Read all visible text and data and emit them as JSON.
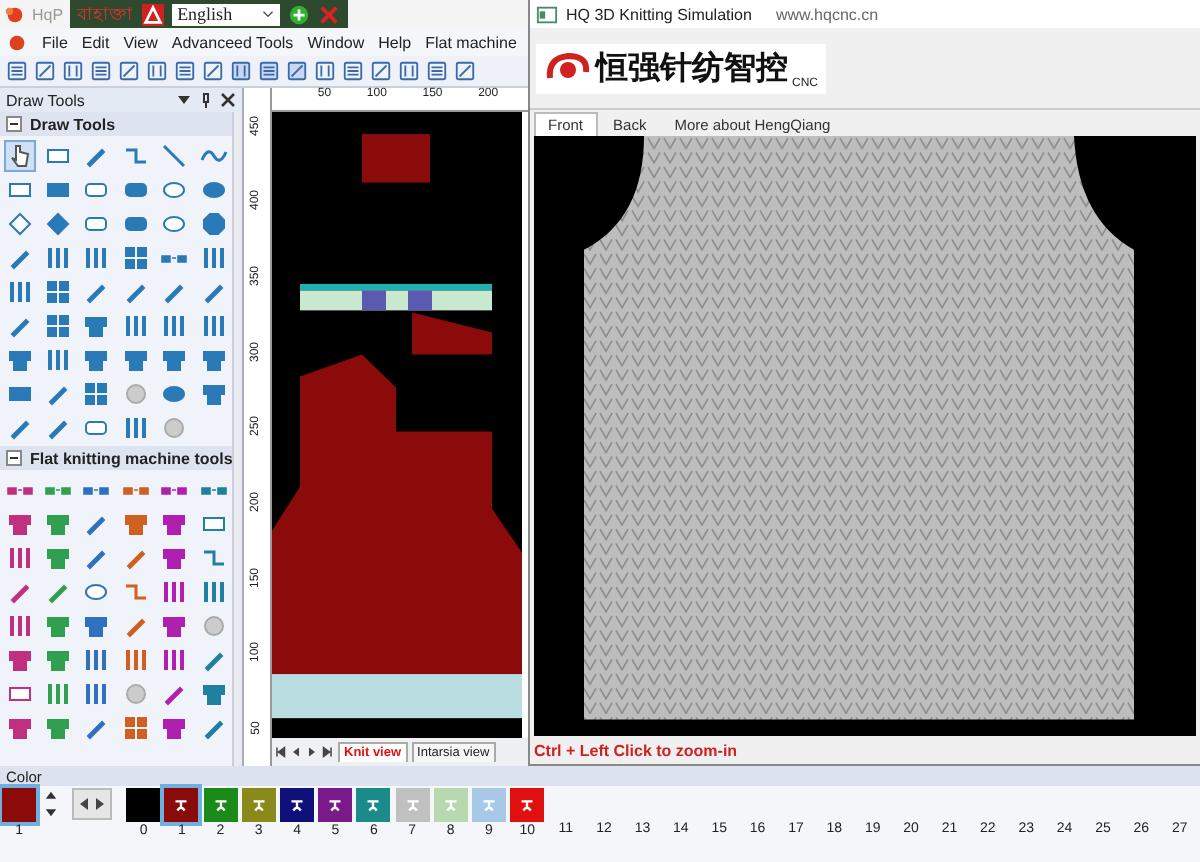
{
  "title_bar": {
    "app_title": "HqP"
  },
  "language_bar": {
    "script_label": "বাহাক্তা",
    "language": "English"
  },
  "menu": [
    "File",
    "Edit",
    "View",
    "Advanceed Tools",
    "Window",
    "Help",
    "Flat machine"
  ],
  "tool_panel": {
    "title": "Draw Tools",
    "sections": [
      "Draw Tools",
      "Flat knitting machine tools"
    ]
  },
  "ruler": {
    "marks": [
      "50",
      "100",
      "150",
      "200"
    ],
    "vertical_marks": [
      "450",
      "400",
      "350",
      "300",
      "250",
      "200",
      "150",
      "100",
      "50"
    ]
  },
  "view_tabs": [
    {
      "label": "Knit view",
      "selected": true
    },
    {
      "label": "Intarsia view",
      "selected": false
    }
  ],
  "simulation": {
    "title": "HQ 3D Knitting Simulation",
    "url": "www.hqcnc.cn",
    "logo_text": "恒强针纺智控",
    "logo_suffix": "CNC",
    "tabs": [
      {
        "label": "Front",
        "selected": true
      },
      {
        "label": "Back",
        "selected": false
      },
      {
        "label": "More about HengQiang",
        "selected": false
      }
    ],
    "hint": "Ctrl + Left Click to zoom-in"
  },
  "color_panel": {
    "title": "Color",
    "current": {
      "label": "1",
      "color": "#8b0a0a"
    },
    "swatches": [
      {
        "label": "0",
        "color": "#000000",
        "selected": false
      },
      {
        "label": "1",
        "color": "#8b0a0a",
        "selected": true
      },
      {
        "label": "2",
        "color": "#1a8a1a",
        "selected": false
      },
      {
        "label": "3",
        "color": "#8a8a1a",
        "selected": false
      },
      {
        "label": "4",
        "color": "#10107a",
        "selected": false
      },
      {
        "label": "5",
        "color": "#7a1a8a",
        "selected": false
      },
      {
        "label": "6",
        "color": "#1a8a8a",
        "selected": false
      },
      {
        "label": "7",
        "color": "#c0c0c0",
        "selected": false
      },
      {
        "label": "8",
        "color": "#b8d8b0",
        "selected": false
      },
      {
        "label": "9",
        "color": "#a8c8e8",
        "selected": false
      },
      {
        "label": "10",
        "color": "#e01010",
        "selected": false
      }
    ],
    "column_numbers": [
      "11",
      "12",
      "13",
      "14",
      "15",
      "16",
      "17",
      "18",
      "19",
      "20",
      "21",
      "22",
      "23",
      "24",
      "25",
      "26",
      "27"
    ]
  }
}
